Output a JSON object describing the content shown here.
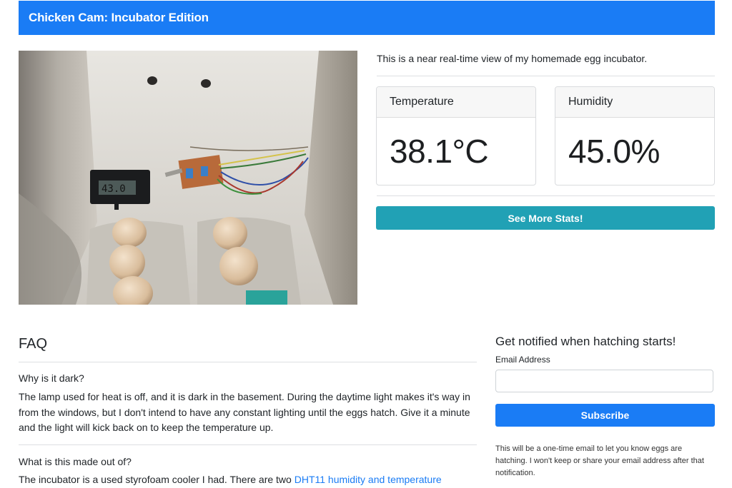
{
  "navbar": {
    "brand": "Chicken Cam: Incubator Edition",
    "color": "#1a7cf5"
  },
  "camera": {
    "description_image": "incubator-camera-feed",
    "thermometer_reading": "43.0"
  },
  "intro": {
    "text": "This is a near real-time view of my homemade egg incubator."
  },
  "stats": {
    "temperature": {
      "label": "Temperature",
      "value": "38.1°C"
    },
    "humidity": {
      "label": "Humidity",
      "value": "45.0%"
    },
    "more_button": "See More Stats!",
    "button_color": "#21a1b5"
  },
  "faq": {
    "title": "FAQ",
    "items": [
      {
        "question": "Why is it dark?",
        "answer": "The lamp used for heat is off, and it is dark in the basement. During the daytime light makes it's way in from the windows, but I don't intend to have any constant lighting until the eggs hatch. Give it a minute and the light will kick back on to keep the temperature up."
      },
      {
        "question": "What is this made out of?",
        "answer_prefix": "The incubator is a used styrofoam cooler I had. There are two ",
        "answer_link": "DHT11 humidity and temperature"
      }
    ]
  },
  "notify": {
    "title": "Get notified when hatching starts!",
    "email_label": "Email Address",
    "email_value": "",
    "subscribe_button": "Subscribe",
    "note": "This will be a one-time email to let you know eggs are hatching. I won't keep or share your email address after that notification."
  }
}
